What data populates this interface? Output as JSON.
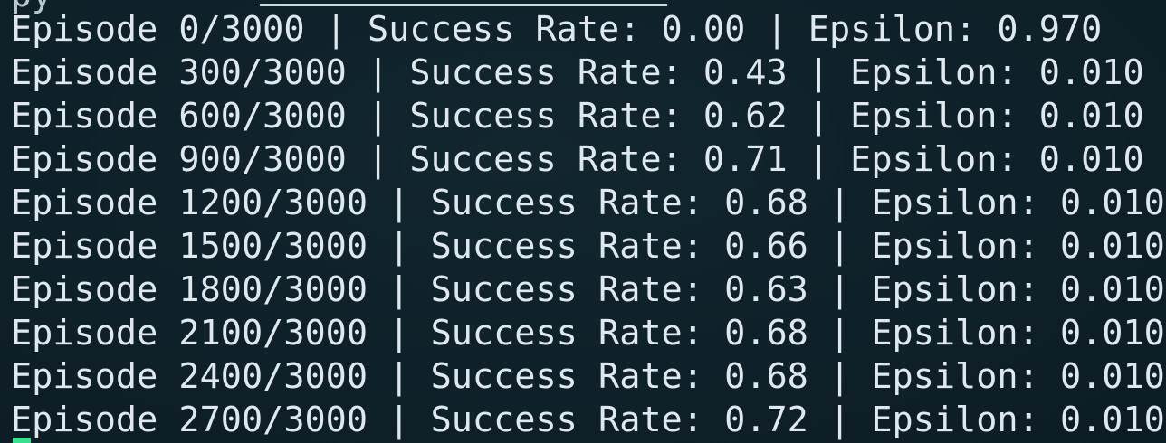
{
  "terminal": {
    "previous_line_fragment": "py",
    "log_lines": [
      "Episode 0/3000 | Success Rate: 0.00 | Epsilon: 0.970",
      "Episode 300/3000 | Success Rate: 0.43 | Epsilon: 0.010",
      "Episode 600/3000 | Success Rate: 0.62 | Epsilon: 0.010",
      "Episode 900/3000 | Success Rate: 0.71 | Epsilon: 0.010",
      "Episode 1200/3000 | Success Rate: 0.68 | Epsilon: 0.010",
      "Episode 1500/3000 | Success Rate: 0.66 | Epsilon: 0.010",
      "Episode 1800/3000 | Success Rate: 0.63 | Epsilon: 0.010",
      "Episode 2100/3000 | Success Rate: 0.68 | Epsilon: 0.010",
      "Episode 2400/3000 | Success Rate: 0.68 | Epsilon: 0.010",
      "Episode 2700/3000 | Success Rate: 0.72 | Epsilon: 0.010"
    ],
    "colors": {
      "background": "#0f222b",
      "text": "#dfe8ee",
      "cursor": "#37e08a"
    }
  }
}
